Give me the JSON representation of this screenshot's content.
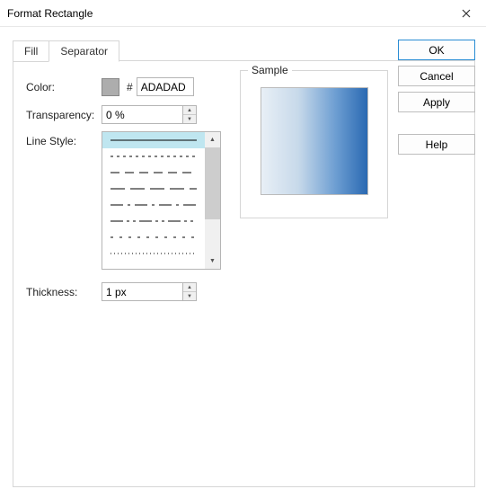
{
  "window": {
    "title": "Format Rectangle"
  },
  "tabs": {
    "fill": "Fill",
    "separator": "Separator"
  },
  "labels": {
    "color": "Color:",
    "transparency": "Transparency:",
    "lineStyle": "Line Style:",
    "thickness": "Thickness:",
    "sample": "Sample",
    "hash": "#"
  },
  "values": {
    "colorHex": "ADADAD",
    "colorSwatch": "#adadad",
    "transparency": "0 %",
    "thickness": "1 px"
  },
  "lineStyles": {
    "selectedIndex": 0,
    "items": [
      {
        "dash": null
      },
      {
        "dash": "3,3"
      },
      {
        "dash": "8,5"
      },
      {
        "dash": "12,4"
      },
      {
        "dash": "12,4,3,4"
      },
      {
        "dash": "12,4,3,4,3,4"
      },
      {
        "dash": "3,5"
      },
      {
        "dash": "1,3"
      }
    ]
  },
  "buttons": {
    "ok": "OK",
    "cancel": "Cancel",
    "apply": "Apply",
    "help": "Help"
  }
}
